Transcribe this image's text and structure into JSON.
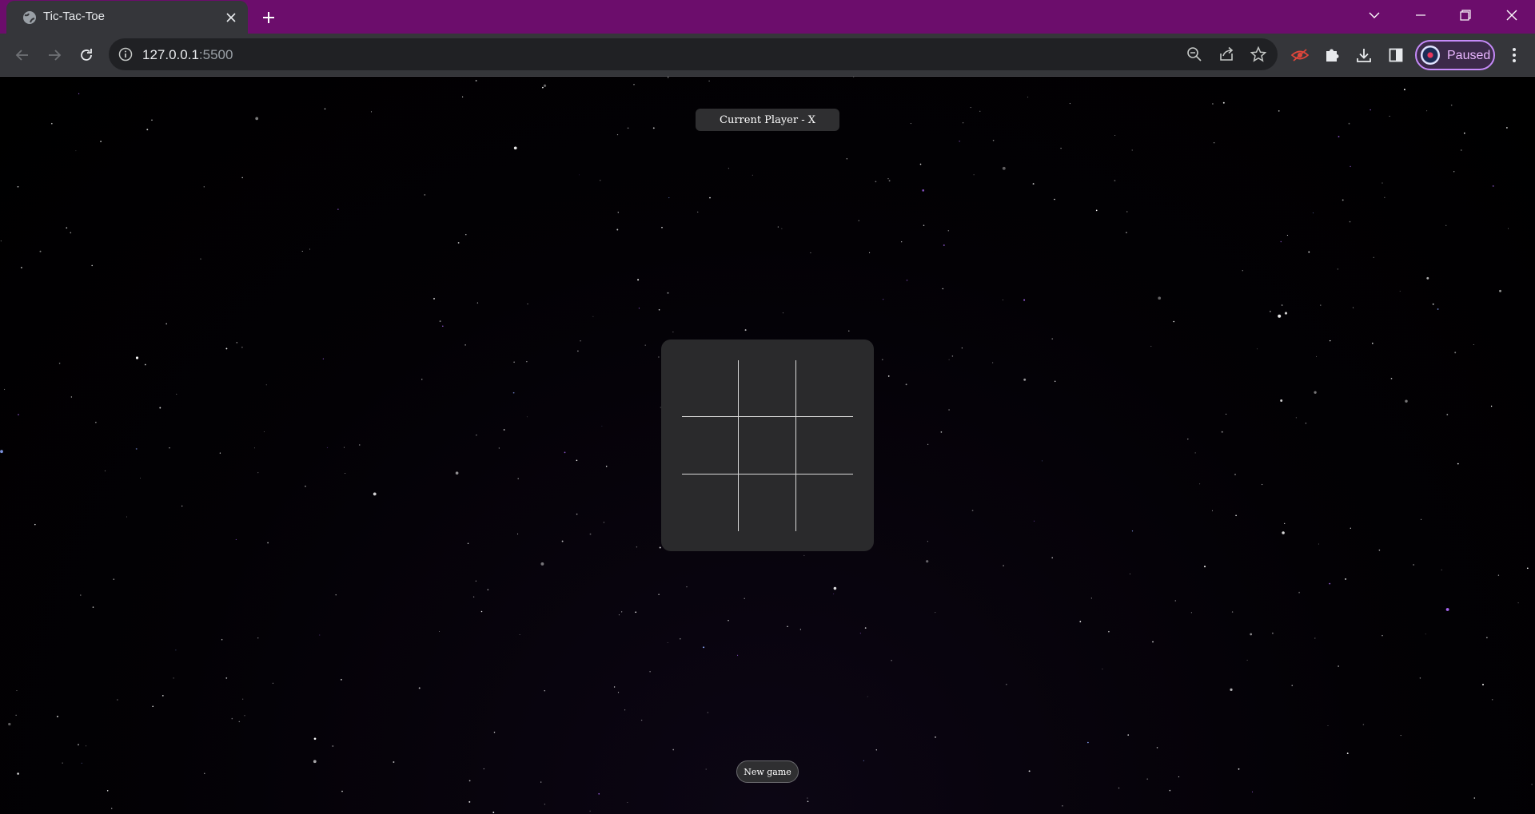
{
  "browser": {
    "tab_title": "Tic-Tac-Toe",
    "url_host": "127.0.0.1",
    "url_port": ":5500",
    "profile_label": "Paused",
    "accent_color": "#6c0d6c"
  },
  "icons": {
    "favicon": "globe-icon",
    "close": "close-icon",
    "new_tab": "plus-icon",
    "back": "back-arrow-icon",
    "forward": "forward-arrow-icon",
    "reload": "reload-icon",
    "info": "info-icon",
    "zoom": "zoom-out-icon",
    "share": "share-icon",
    "bookmark": "star-icon",
    "extensions": [
      "eye-off-icon",
      "puzzle-icon",
      "download-icon",
      "side-panel-icon"
    ],
    "menu": "kebab-menu-icon"
  },
  "game": {
    "status_text": "Current Player - X",
    "board": [
      "",
      "",
      "",
      "",
      "",
      "",
      "",
      "",
      ""
    ],
    "new_game_label": "New game"
  }
}
